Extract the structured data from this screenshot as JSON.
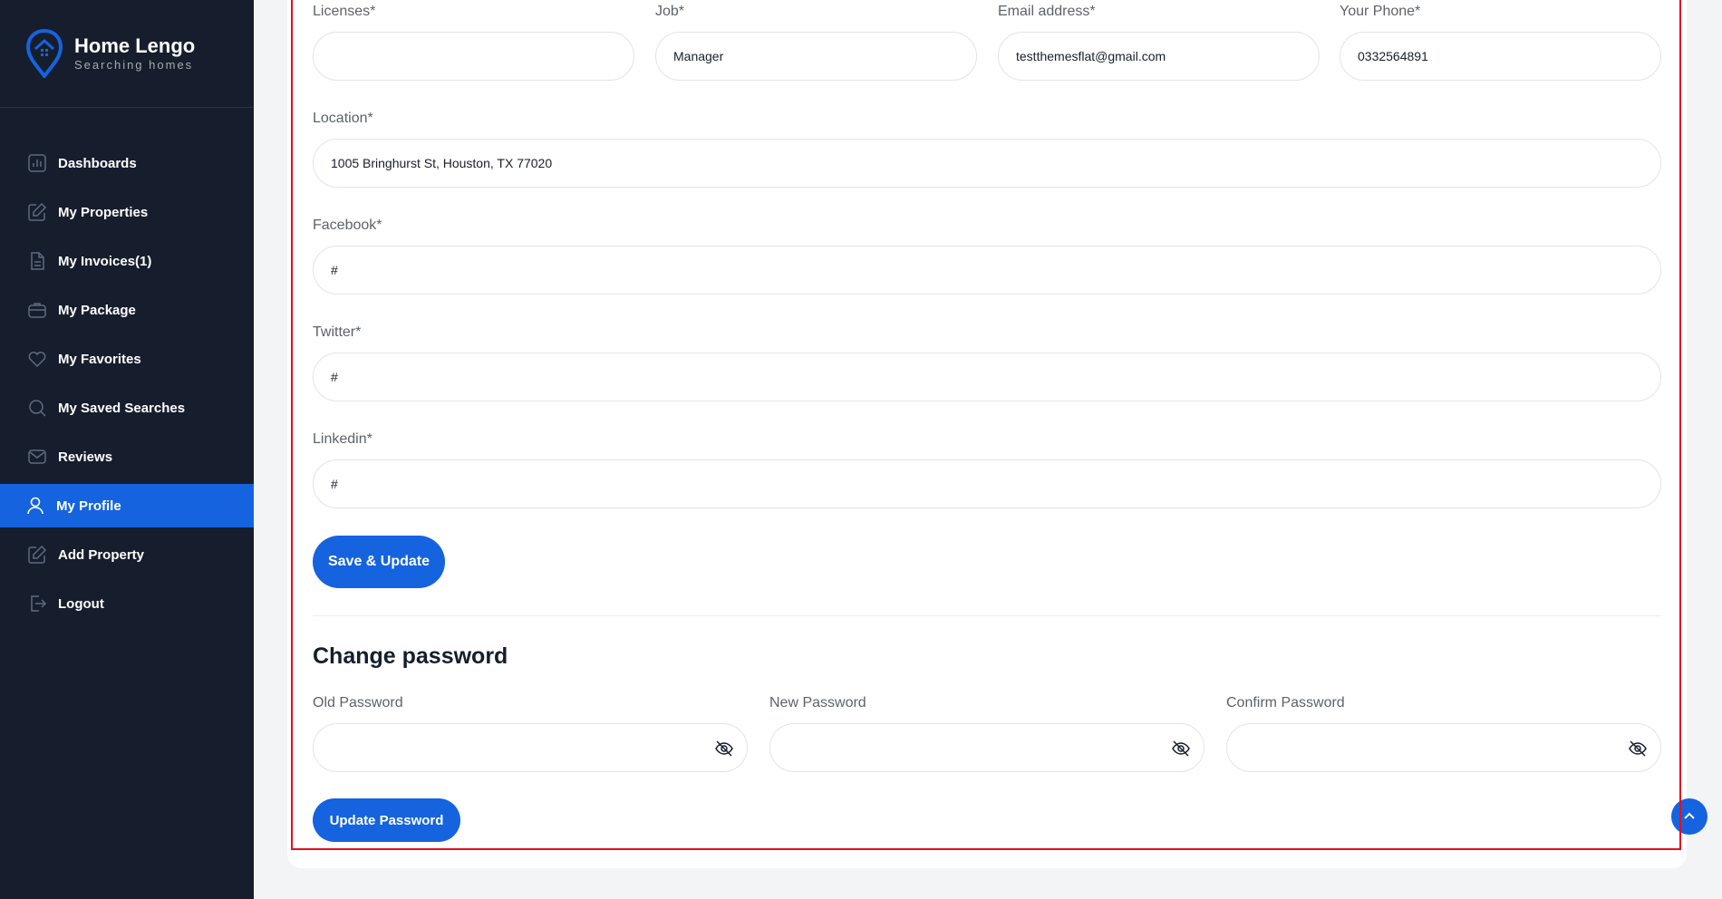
{
  "brand": {
    "name": "Home Lengo",
    "tagline": "Searching homes"
  },
  "sidebar": {
    "items": [
      {
        "label": "Dashboards",
        "icon": "chart-icon"
      },
      {
        "label": "My Properties",
        "icon": "edit-icon"
      },
      {
        "label": "My Invoices(1)",
        "icon": "document-icon"
      },
      {
        "label": "My Package",
        "icon": "briefcase-icon"
      },
      {
        "label": "My Favorites",
        "icon": "heart-icon"
      },
      {
        "label": "My Saved Searches",
        "icon": "search-icon"
      },
      {
        "label": "Reviews",
        "icon": "mail-icon"
      },
      {
        "label": "My Profile",
        "icon": "user-icon",
        "active": true
      },
      {
        "label": "Add Property",
        "icon": "edit-icon"
      },
      {
        "label": "Logout",
        "icon": "logout-icon"
      }
    ]
  },
  "form": {
    "licenses": {
      "label": "Licenses*",
      "value": ""
    },
    "job": {
      "label": "Job*",
      "value": "Manager"
    },
    "email": {
      "label": "Email address*",
      "value": "testthemesflat@gmail.com"
    },
    "phone": {
      "label": "Your Phone*",
      "value": "0332564891"
    },
    "location": {
      "label": "Location*",
      "value": "1005 Bringhurst St, Houston, TX 77020"
    },
    "facebook": {
      "label": "Facebook*",
      "value": "#"
    },
    "twitter": {
      "label": "Twitter*",
      "value": "#"
    },
    "linkedin": {
      "label": "Linkedin*",
      "value": "#"
    },
    "save_label": "Save & Update"
  },
  "password": {
    "title": "Change password",
    "old": {
      "label": "Old Password",
      "value": ""
    },
    "new": {
      "label": "New Password",
      "value": ""
    },
    "confirm": {
      "label": "Confirm Password",
      "value": ""
    },
    "update_label": "Update Password"
  },
  "colors": {
    "accent": "#1563df",
    "sidebar_bg": "#161e2d",
    "highlight_frame": "#e0101f"
  }
}
